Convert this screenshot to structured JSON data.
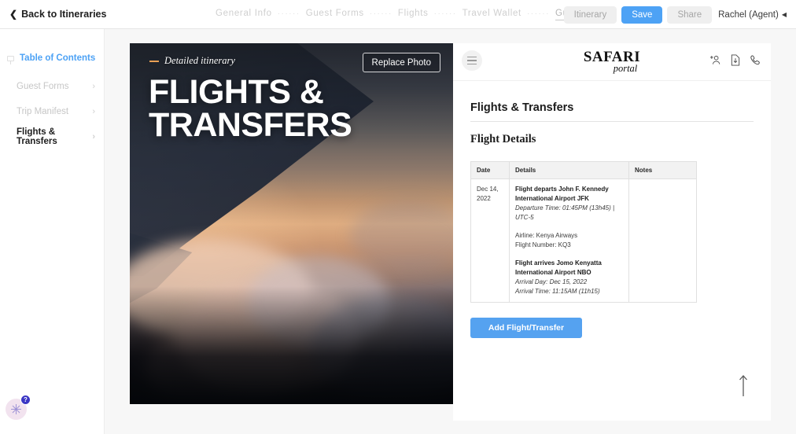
{
  "topbar": {
    "back_label": "Back to Itineraries",
    "back_icon": "chevron-left-icon",
    "wizard_steps": [
      {
        "label": "General Info",
        "active": false
      },
      {
        "label": "Guest Forms",
        "active": false
      },
      {
        "label": "Flights",
        "active": false
      },
      {
        "label": "Travel Wallet",
        "active": false
      },
      {
        "label": "Guest Portal",
        "active": true
      }
    ],
    "dots": "······",
    "itinerary_label": "Itinerary",
    "save_label": "Save",
    "share_label": "Share",
    "user_label": "Rachel (Agent)",
    "user_caret": "◀",
    "accent_color": "#4da2f5"
  },
  "sidebar": {
    "toc_title": "Table of Contents",
    "toc_icon": "document-outline-icon",
    "items": [
      {
        "label": "Guest Forms",
        "active": false
      },
      {
        "label": "Trip Manifest",
        "active": false
      },
      {
        "label": "Flights & Transfers",
        "active": true
      }
    ],
    "chevron": "›",
    "active_color": "#1d1d1d",
    "title_color": "#4da2f5"
  },
  "hero": {
    "kicker": "Detailed itinerary",
    "title_line1": "FLIGHTS &",
    "title_line2": "TRANSFERS",
    "replace_photo_label": "Replace Photo",
    "kicker_dash_color": "#e8a055"
  },
  "preview": {
    "menu_icon": "hamburger-menu-icon",
    "brand_main": "SAFARI",
    "brand_sub": "portal",
    "header_icons": [
      "add-person-icon",
      "document-download-icon",
      "phone-icon"
    ],
    "heading": "Flights & Transfers",
    "subheading": "Flight Details",
    "table": {
      "columns": [
        "Date",
        "Details",
        "Notes"
      ],
      "rows": [
        {
          "date": "Dec 14, 2022",
          "details": [
            {
              "text": "Flight departs John F. Kennedy International Airport JFK",
              "style": "bold"
            },
            {
              "text": "Departure Time: 01:45PM (13h45) | UTC-5",
              "style": "italic"
            },
            {
              "text": "",
              "style": "gap"
            },
            {
              "text": "Airline: Kenya Airways",
              "style": "normal"
            },
            {
              "text": "Flight Number: KQ3",
              "style": "normal"
            },
            {
              "text": "",
              "style": "gap"
            },
            {
              "text": "Flight arrives Jomo Kenyatta International Airport NBO",
              "style": "bold"
            },
            {
              "text": "Arrival Day: Dec 15, 2022",
              "style": "italic"
            },
            {
              "text": "Arrival Time: 11:15AM (11h15)",
              "style": "italic"
            }
          ],
          "notes": ""
        }
      ]
    },
    "add_button_label": "Add Flight/Transfer",
    "add_button_color": "#55a2f0",
    "scroll_top_icon": "arrow-up-icon"
  },
  "help": {
    "badge_count": "?",
    "icon": "sparkle-help-icon",
    "badge_color": "#3b36c4"
  }
}
